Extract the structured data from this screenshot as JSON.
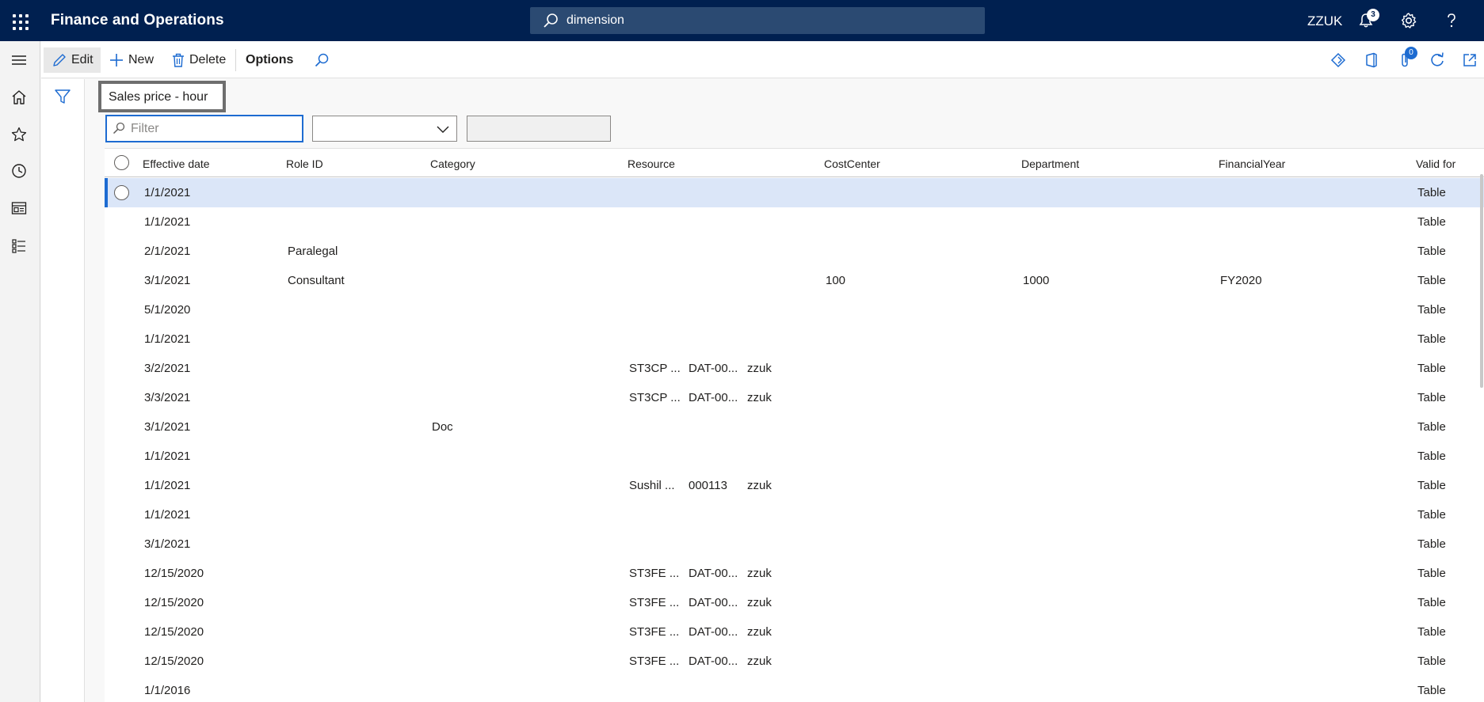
{
  "app": {
    "title": "Finance and Operations"
  },
  "search": {
    "value": "dimension"
  },
  "user": {
    "company": "ZZUK"
  },
  "notifications": {
    "count": "3"
  },
  "actions": {
    "edit": "Edit",
    "new": "New",
    "delete": "Delete",
    "options": "Options",
    "attachments_count": "0"
  },
  "view": {
    "title": "Sales price - hour",
    "filter_placeholder": "Filter"
  },
  "grid": {
    "headers": {
      "effective_date": "Effective date",
      "role_id": "Role ID",
      "category": "Category",
      "resource": "Resource",
      "cost_center": "CostCenter",
      "department": "Department",
      "financial_year": "FinancialYear",
      "valid_for": "Valid for"
    },
    "rows": [
      {
        "date": "1/1/2021",
        "role": "",
        "category": "",
        "res1": "",
        "res2": "",
        "res3": "",
        "cc": "",
        "dept": "",
        "fy": "",
        "valid": "Table"
      },
      {
        "date": "1/1/2021",
        "role": "",
        "category": "",
        "res1": "",
        "res2": "",
        "res3": "",
        "cc": "",
        "dept": "",
        "fy": "",
        "valid": "Table"
      },
      {
        "date": "2/1/2021",
        "role": "Paralegal",
        "category": "",
        "res1": "",
        "res2": "",
        "res3": "",
        "cc": "",
        "dept": "",
        "fy": "",
        "valid": "Table"
      },
      {
        "date": "3/1/2021",
        "role": "Consultant",
        "category": "",
        "res1": "",
        "res2": "",
        "res3": "",
        "cc": "100",
        "dept": "1000",
        "fy": "FY2020",
        "valid": "Table"
      },
      {
        "date": "5/1/2020",
        "role": "",
        "category": "",
        "res1": "",
        "res2": "",
        "res3": "",
        "cc": "",
        "dept": "",
        "fy": "",
        "valid": "Table"
      },
      {
        "date": "1/1/2021",
        "role": "",
        "category": "",
        "res1": "",
        "res2": "",
        "res3": "",
        "cc": "",
        "dept": "",
        "fy": "",
        "valid": "Table"
      },
      {
        "date": "3/2/2021",
        "role": "",
        "category": "",
        "res1": "ST3CP ...",
        "res2": "DAT-00...",
        "res3": "zzuk",
        "cc": "",
        "dept": "",
        "fy": "",
        "valid": "Table"
      },
      {
        "date": "3/3/2021",
        "role": "",
        "category": "",
        "res1": "ST3CP ...",
        "res2": "DAT-00...",
        "res3": "zzuk",
        "cc": "",
        "dept": "",
        "fy": "",
        "valid": "Table"
      },
      {
        "date": "3/1/2021",
        "role": "",
        "category": "Doc",
        "res1": "",
        "res2": "",
        "res3": "",
        "cc": "",
        "dept": "",
        "fy": "",
        "valid": "Table"
      },
      {
        "date": "1/1/2021",
        "role": "",
        "category": "",
        "res1": "",
        "res2": "",
        "res3": "",
        "cc": "",
        "dept": "",
        "fy": "",
        "valid": "Table"
      },
      {
        "date": "1/1/2021",
        "role": "",
        "category": "",
        "res1": "Sushil ...",
        "res2": "000113",
        "res3": "zzuk",
        "cc": "",
        "dept": "",
        "fy": "",
        "valid": "Table"
      },
      {
        "date": "1/1/2021",
        "role": "",
        "category": "",
        "res1": "",
        "res2": "",
        "res3": "",
        "cc": "",
        "dept": "",
        "fy": "",
        "valid": "Table"
      },
      {
        "date": "3/1/2021",
        "role": "",
        "category": "",
        "res1": "",
        "res2": "",
        "res3": "",
        "cc": "",
        "dept": "",
        "fy": "",
        "valid": "Table"
      },
      {
        "date": "12/15/2020",
        "role": "",
        "category": "",
        "res1": "ST3FE ...",
        "res2": "DAT-00...",
        "res3": "zzuk",
        "cc": "",
        "dept": "",
        "fy": "",
        "valid": "Table"
      },
      {
        "date": "12/15/2020",
        "role": "",
        "category": "",
        "res1": "ST3FE ...",
        "res2": "DAT-00...",
        "res3": "zzuk",
        "cc": "",
        "dept": "",
        "fy": "",
        "valid": "Table"
      },
      {
        "date": "12/15/2020",
        "role": "",
        "category": "",
        "res1": "ST3FE ...",
        "res2": "DAT-00...",
        "res3": "zzuk",
        "cc": "",
        "dept": "",
        "fy": "",
        "valid": "Table"
      },
      {
        "date": "12/15/2020",
        "role": "",
        "category": "",
        "res1": "ST3FE ...",
        "res2": "DAT-00...",
        "res3": "zzuk",
        "cc": "",
        "dept": "",
        "fy": "",
        "valid": "Table"
      },
      {
        "date": "1/1/2016",
        "role": "",
        "category": "",
        "res1": "",
        "res2": "",
        "res3": "",
        "cc": "",
        "dept": "",
        "fy": "",
        "valid": "Table"
      }
    ]
  },
  "colors": {
    "topbar": "#002050",
    "accent": "#1d6bd1",
    "selected_row": "#dbe6f8"
  },
  "icons": [
    "app-launcher-icon",
    "search-icon",
    "bell-icon",
    "gear-icon",
    "help-icon",
    "hamburger-icon",
    "home-icon",
    "star-icon",
    "clock-icon",
    "workspace-icon",
    "list-icon",
    "filter-icon",
    "pencil-icon",
    "plus-icon",
    "trash-icon",
    "find-icon",
    "diamond-icon",
    "office-icon",
    "paperclip-icon",
    "refresh-icon",
    "popout-icon",
    "chevron-down-icon"
  ]
}
